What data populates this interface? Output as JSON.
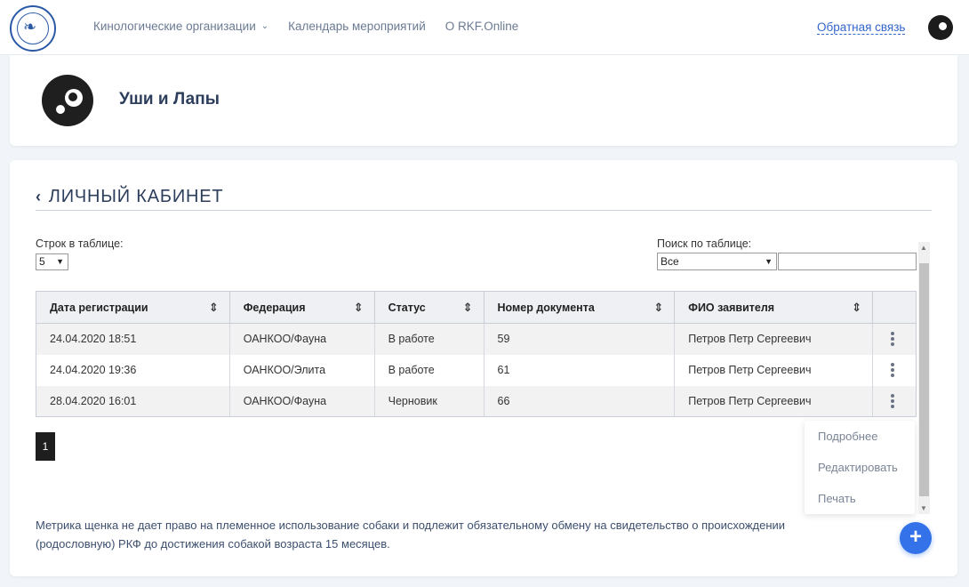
{
  "header": {
    "nav": [
      {
        "label": "Кинологические организации",
        "has_dropdown": true
      },
      {
        "label": "Календарь мероприятий",
        "has_dropdown": false
      },
      {
        "label": "О RKF.Online",
        "has_dropdown": false
      }
    ],
    "feedback_label": "Обратная связь"
  },
  "profile": {
    "name": "Уши и Лапы"
  },
  "section": {
    "title": "ЛИЧНЫЙ КАБИНЕТ"
  },
  "table_controls": {
    "rows_label": "Строк в таблице:",
    "rows_value": "5",
    "search_label": "Поиск по таблице:",
    "search_scope": "Все",
    "search_value": ""
  },
  "table": {
    "columns": [
      "Дата регистрации",
      "Федерация",
      "Статус",
      "Номер документа",
      "ФИО заявителя"
    ],
    "rows": [
      [
        "24.04.2020 18:51",
        "ОАНКОО/Фауна",
        "В работе",
        "59",
        "Петров Петр Сергеевич"
      ],
      [
        "24.04.2020 19:36",
        "ОАНКОО/Элита",
        "В работе",
        "61",
        "Петров Петр Сергеевич"
      ],
      [
        "28.04.2020 16:01",
        "ОАНКОО/Фауна",
        "Черновик",
        "66",
        "Петров Петр Сергеевич"
      ]
    ]
  },
  "pagination": {
    "current_page": "1"
  },
  "context_menu": [
    "Подробнее",
    "Редактировать",
    "Печать"
  ],
  "note": "Метрика щенка не дает право на племенное использование собаки и подлежит обязательному обмену на свидетельство о происхождении (родословную) РКФ до достижения собакой возраста 15 месяцев.",
  "colors": {
    "accent": "#3372e8",
    "link": "#3366cc",
    "text": "#3d4f6e"
  },
  "icons": {
    "sort": "sort-icon",
    "row_menu": "kebab-icon",
    "add": "plus-icon",
    "back": "chevron-left-icon"
  }
}
